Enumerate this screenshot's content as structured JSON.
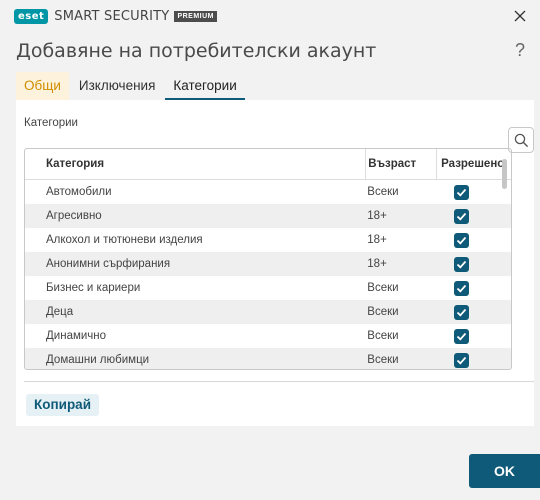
{
  "window": {
    "logo_text": "eset",
    "product_name": "SMART SECURITY",
    "edition_badge": "PREMIUM",
    "close_icon": "close-icon"
  },
  "header": {
    "title": "Добавяне на потребителски акаунт",
    "help_label": "?"
  },
  "tabs": [
    {
      "label": "Общи",
      "state": "highlighted"
    },
    {
      "label": "Изключения",
      "state": "normal"
    },
    {
      "label": "Категории",
      "state": "active"
    }
  ],
  "categories": {
    "section_label": "Категории",
    "search_icon": "search-icon",
    "columns": [
      "Категория",
      "Възраст",
      "Разрешено"
    ],
    "rows": [
      {
        "category": "Автомобили",
        "age": "Всеки",
        "allowed": true
      },
      {
        "category": "Агресивно",
        "age": "18+",
        "allowed": true
      },
      {
        "category": "Алкохол и тютюневи изделия",
        "age": "18+",
        "allowed": true
      },
      {
        "category": "Анонимни сърфирания",
        "age": "18+",
        "allowed": true
      },
      {
        "category": "Бизнес и кариери",
        "age": "Всеки",
        "allowed": true
      },
      {
        "category": "Деца",
        "age": "Всеки",
        "allowed": true
      },
      {
        "category": "Динамично",
        "age": "Всеки",
        "allowed": true
      },
      {
        "category": "Домашни любимци",
        "age": "Всеки",
        "allowed": true
      }
    ]
  },
  "actions": {
    "copy_label": "Копирай",
    "ok_label": "OK"
  },
  "colors": {
    "accent": "#0f5a78",
    "brand": "#0096a6",
    "general_tab_bg": "#fdf3dc",
    "general_tab_text": "#d08c00"
  }
}
